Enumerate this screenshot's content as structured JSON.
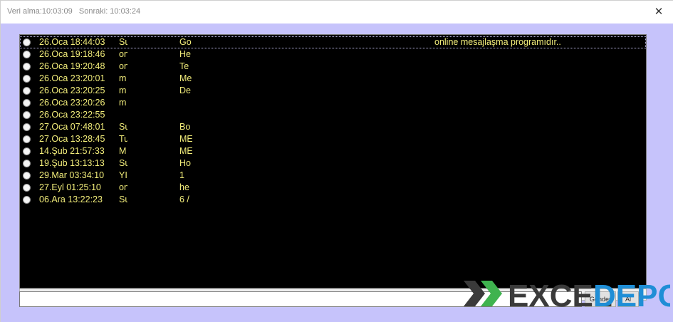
{
  "window": {
    "title": "Veri alma:10:03:09   Sonraki: 10:03:24",
    "close_glyph": "✕"
  },
  "list": {
    "rows": [
      {
        "date": "26.Oca 18:44:03",
        "user": "Su",
        "msg": "Go",
        "tail": "online mesajlaşma programıdır..",
        "selected": true
      },
      {
        "date": "26.Oca 19:18:46",
        "user": "on",
        "msg": "He",
        "tail": ""
      },
      {
        "date": "26.Oca 19:20:48",
        "user": "on",
        "msg": "Te",
        "tail": ""
      },
      {
        "date": "26.Oca 23:20:01",
        "user": "m",
        "msg": "Me",
        "tail": ""
      },
      {
        "date": "26.Oca 23:20:25",
        "user": "m",
        "msg": "De",
        "tail": ""
      },
      {
        "date": "26.Oca 23:20:26",
        "user": "m",
        "msg": "",
        "tail": ""
      },
      {
        "date": "26.Oca 23:22:55",
        "user": "",
        "msg": "",
        "tail": ""
      },
      {
        "date": "27.Oca 07:48:01",
        "user": "Su",
        "msg": "Bo",
        "tail": ""
      },
      {
        "date": "27.Oca 13:28:45",
        "user": "Tu",
        "msg": "ME",
        "tail": ""
      },
      {
        "date": "14.Şub 21:57:33",
        "user": "M",
        "msg": "ME",
        "tail": ""
      },
      {
        "date": "19.Şub 13:13:13",
        "user": "Su",
        "msg": "Ho",
        "tail": ""
      },
      {
        "date": "29.Mar 03:34:10",
        "user": "YI",
        "msg": "1",
        "tail": ""
      },
      {
        "date": "27.Eyl 01:25:10",
        "user": "on",
        "msg": "he",
        "tail": ""
      },
      {
        "date": "06.Ara 13:22:23",
        "user": "Su",
        "msg": "6 /",
        "tail": ""
      }
    ]
  },
  "scroll": {
    "left_glyph": "◀",
    "right_glyph": "▶"
  },
  "message_input": {
    "value": ""
  },
  "buttons": {
    "send_label": "Gönder",
    "second_label": "Al"
  },
  "watermark": {
    "part1": "EXCEL",
    "part2": "DEPO",
    "color_dark": "#3a3a3a",
    "color_green": "#3fb34f",
    "color_blue": "#1f8ed6"
  },
  "colors": {
    "client_bg": "#c6c3fb",
    "list_bg": "#000000",
    "list_text": "#f2ed7a"
  }
}
